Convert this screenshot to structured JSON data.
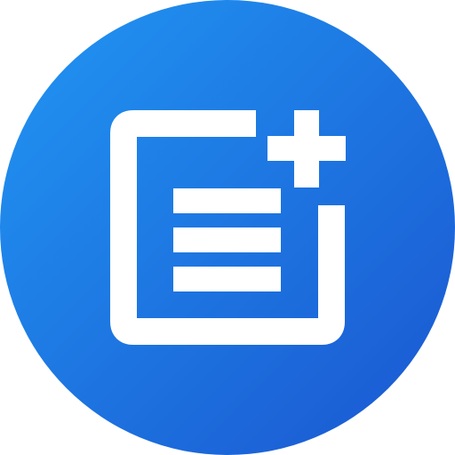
{
  "icon": {
    "name": "add-note-icon",
    "glyph_parts": [
      "note-frame",
      "text-lines",
      "plus-sign"
    ],
    "colors": {
      "gradient_start": "#2196F3",
      "gradient_end": "#1A56D0",
      "glyph": "#FFFFFF"
    }
  }
}
